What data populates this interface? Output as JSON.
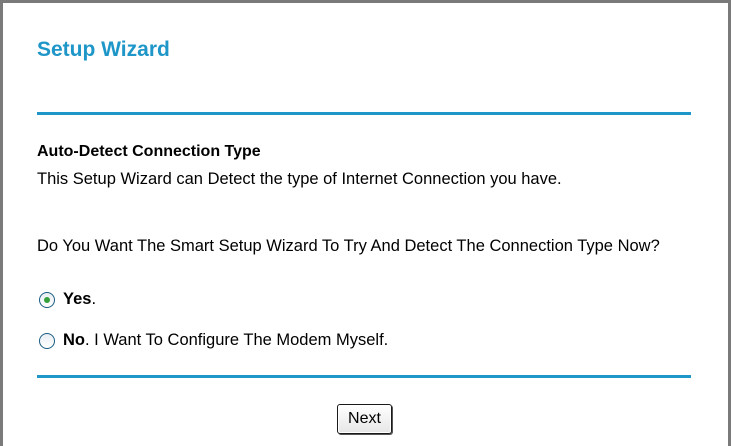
{
  "wizard": {
    "title": "Setup Wizard",
    "section_heading": "Auto-Detect Connection Type",
    "description": "This Setup Wizard can Detect the type of Internet Connection you have.",
    "question": "Do You Want The Smart Setup Wizard To Try And Detect The Connection Type Now?",
    "options": [
      {
        "bold": "Yes",
        "rest": ".",
        "selected": true
      },
      {
        "bold": "No",
        "rest": ". I Want To Configure The Modem Myself.",
        "selected": false
      }
    ],
    "next_label": "Next"
  },
  "colors": {
    "accent": "#1f96c8",
    "radio_dot": "#36a03a",
    "frame_border": "#7a7a7a"
  }
}
